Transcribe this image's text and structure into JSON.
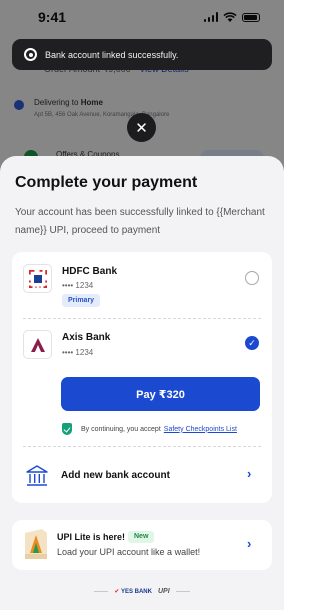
{
  "status_bar": {
    "time": "9:41"
  },
  "background": {
    "order_text": "Order Amount",
    "order_amount": "₹9,000",
    "view_details": "View Details",
    "delivering_prefix": "Delivering to",
    "delivering_label": "Home",
    "address": "Apt 5B, 456 Oak Avenue, Koramangala, Bangalore",
    "offers_text": "Offers & Coupons"
  },
  "toast": {
    "message": "Bank account linked successfully."
  },
  "close": {
    "symbol": "✕"
  },
  "sheet": {
    "title": "Complete your payment",
    "subtitle": "Your account has been successfully linked to {{Merchant name}} UPI, proceed to payment"
  },
  "banks": [
    {
      "name": "HDFC Bank",
      "account": "•••• 1234",
      "badge": "Primary",
      "selected": false
    },
    {
      "name": "Axis Bank",
      "account": "•••• 1234",
      "selected": true
    }
  ],
  "pay_button": {
    "label": "Pay ₹320"
  },
  "consent": {
    "text": "By continuing, you accept",
    "link": "Safety Checkpoints List"
  },
  "add_bank": {
    "label": "Add new bank account"
  },
  "upi_lite": {
    "title": "UPI Lite is here!",
    "badge": "New",
    "subtitle": "Load your UPI account like a wallet!"
  },
  "footer": {
    "partner": "YES BANK",
    "upi": "UPI"
  },
  "colors": {
    "accent": "#1b4ad0",
    "toast_bg": "#1f1f22",
    "success": "#13a07a"
  }
}
